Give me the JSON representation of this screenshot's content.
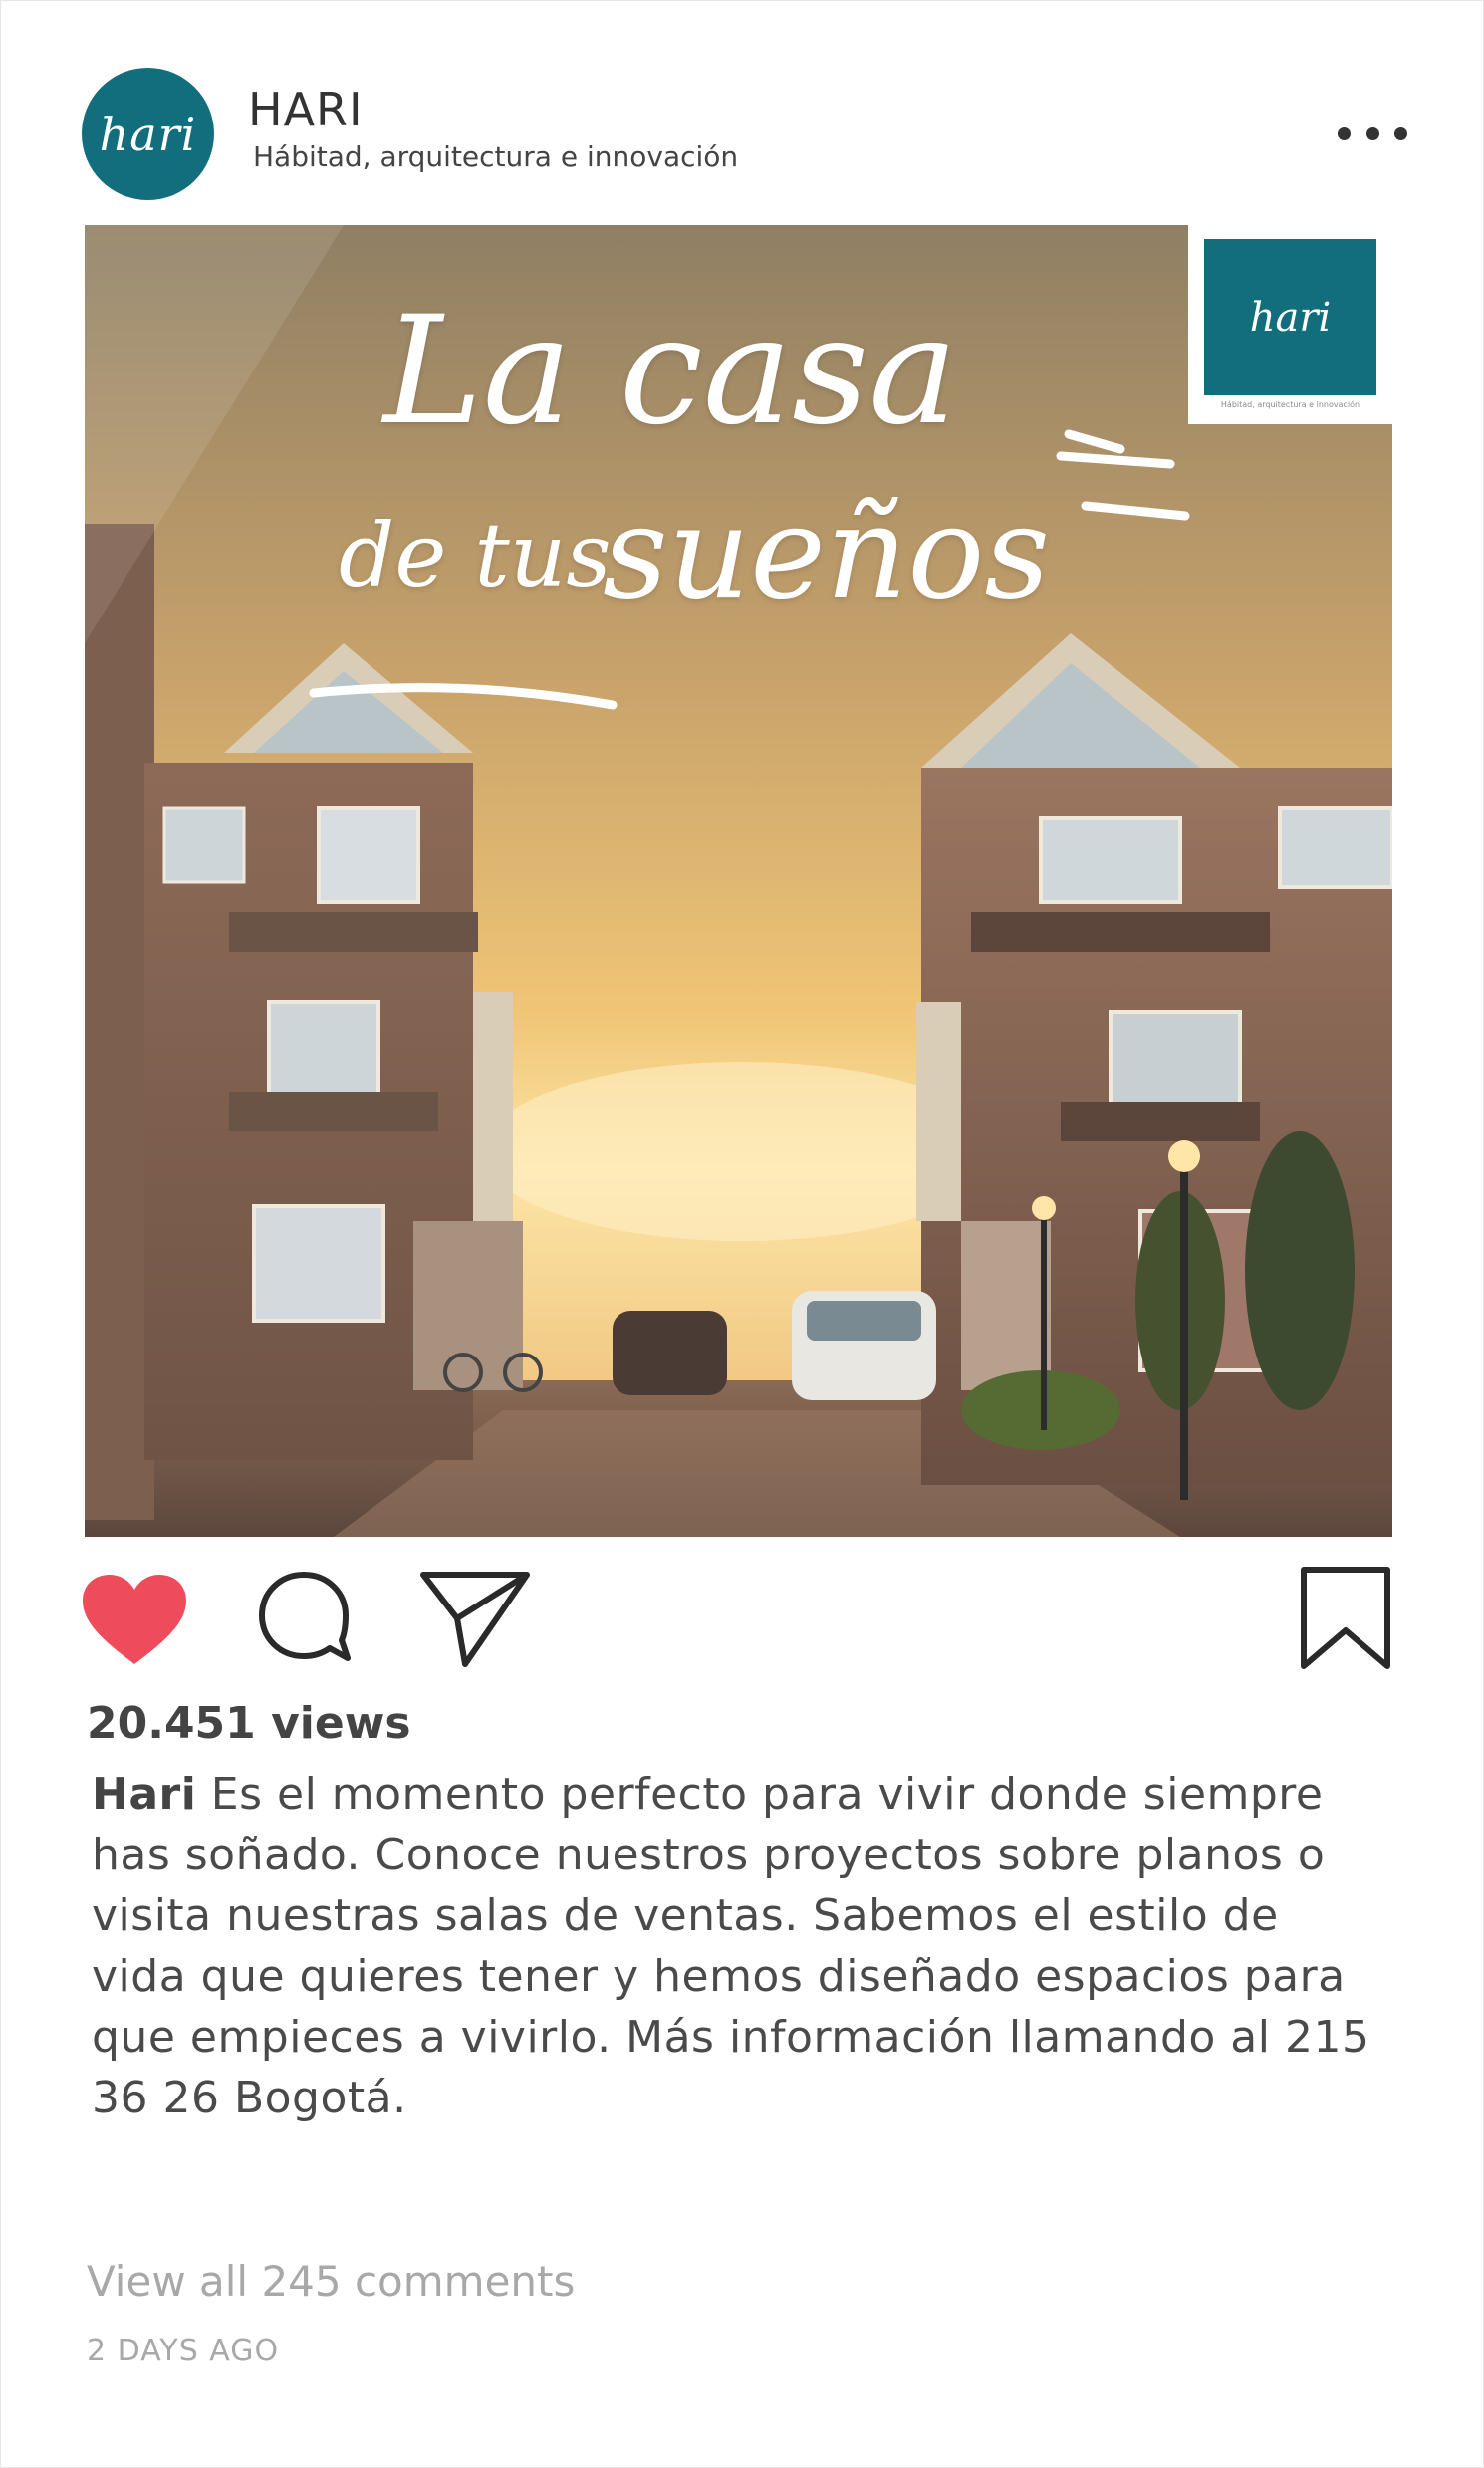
{
  "colors": {
    "brand_teal": "#126e7c",
    "like_red": "#ee4c5c",
    "text_dark": "#3d3d3d",
    "text_muted": "#a8a8a8"
  },
  "header": {
    "avatar_text": "hari",
    "username": "HARI",
    "subtitle": "Hábitad, arquitectura e innovación",
    "more_icon": "more-horizontal-icon"
  },
  "post": {
    "image": {
      "headline_line1": "La casa",
      "headline_line2a": "de tus",
      "headline_line2b": "sueños",
      "logo_text": "hari",
      "logo_tagline": "Hábitad, arquitectura e innovación"
    }
  },
  "actions": {
    "like_icon": "heart-icon",
    "comment_icon": "speech-bubble-icon",
    "share_icon": "paper-plane-icon",
    "save_icon": "bookmark-icon",
    "liked": true
  },
  "stats": {
    "views": "20.451 views"
  },
  "caption": {
    "author": "Hari",
    "text": " Es el momento perfecto para vivir donde siempre has soñado. Conoce nuestros proyectos sobre planos o visita nuestras salas de ventas. Sabemos el estilo de vida que quieres tener y hemos diseñado espacios para que empieces a vivirlo.  Más información llamando al 215 36 26 Bogotá."
  },
  "comments": {
    "view_all": "View all 245 comments"
  },
  "timestamp": "2 DAYS AGO"
}
